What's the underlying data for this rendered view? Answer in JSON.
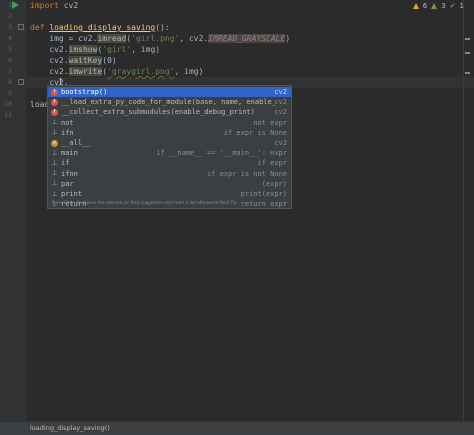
{
  "gutter": {
    "lines": [
      "1",
      "2",
      "3",
      "4",
      "5",
      "6",
      "7",
      "8",
      "9",
      "10",
      "11"
    ]
  },
  "code": {
    "line1": {
      "kw": "import",
      "rest": " cv2"
    },
    "line3": {
      "kw": "def",
      "name": "loading_display_saving",
      "rest": "():"
    },
    "line4": {
      "pre": "    img = cv2.",
      "fn": "imread",
      "open": "(",
      "str": "'girl.png'",
      "mid": ", cv2.",
      "const": "IMREAD_GRAYSCALE",
      "close": ")"
    },
    "line5": {
      "pre": "    cv2.",
      "fn": "imshow",
      "open": "(",
      "str": "'girl'",
      "rest": ", img)"
    },
    "line6": {
      "pre": "    cv2.",
      "fn": "waitKey",
      "rest": "(0)"
    },
    "line7": {
      "pre": "    cv2.",
      "fn": "imwrite",
      "open": "(",
      "str": "'graygirl.png'",
      "rest": ", img)"
    },
    "line8": {
      "pre": "    cv2."
    },
    "line10_partial": "load"
  },
  "inspection": {
    "warnings": "6",
    "weak_warnings": "3",
    "ok_count": "1"
  },
  "completion": {
    "items": [
      {
        "icon": "f",
        "name": "bootstrap()",
        "type": "cv2",
        "selected": true
      },
      {
        "icon": "f",
        "name": "__load_extra_py_code_for_module(base, name, enable_",
        "type": "cv2",
        "selected": false
      },
      {
        "icon": "f",
        "name": "__collect_extra_submodules(enable_debug_print)",
        "type": "cv2",
        "selected": false
      },
      {
        "icon": "t",
        "name": "not",
        "type": "not expr",
        "selected": false
      },
      {
        "icon": "t",
        "name": "ifn",
        "type": "if expr is None",
        "selected": false
      },
      {
        "icon": "v",
        "name": "__all__",
        "type": "cv2",
        "selected": false
      },
      {
        "icon": "t",
        "name": "main",
        "type": "if __name__ == '__main__': expr",
        "selected": false
      },
      {
        "icon": "t",
        "name": "if",
        "type": "if expr",
        "selected": false
      },
      {
        "icon": "t",
        "name": "ifnn",
        "type": "if expr is not None",
        "selected": false
      },
      {
        "icon": "t",
        "name": "par",
        "type": "(expr)",
        "selected": false
      },
      {
        "icon": "t",
        "name": "print",
        "type": "print(expr)",
        "selected": false
      },
      {
        "icon": "t",
        "name": "return",
        "type": "return expr",
        "selected": false
      }
    ],
    "hint": "Press Ctrl+. to choose the selected (or first) suggestion and insert a dot afterwards",
    "hint_link": "Next Tip",
    "menu": "⋮"
  },
  "status": {
    "breadcrumb": "loading_display_saving()"
  },
  "colors": {
    "background": "#2b2b2b",
    "selection": "#2f65ca",
    "keyword": "#cc7832",
    "function": "#ffc66d",
    "string": "#6a8759"
  }
}
